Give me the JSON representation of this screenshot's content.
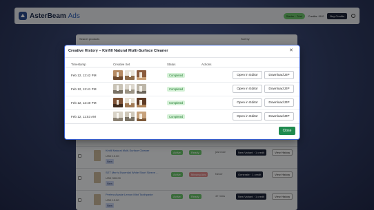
{
  "app": {
    "brand": "AsterBeam",
    "brand_accent": "Ads",
    "plan_badge": "Starter · Trial",
    "credits": "Credits: 99.0",
    "buy_credits": "Buy Credits",
    "help_icon": "help-circle-icon"
  },
  "background": {
    "search_label": "Search products",
    "sort_label": "Sort by",
    "rows": [
      {
        "name": "Kinfill Natural Multi-Surface Cleaner",
        "price": "USD 13.00",
        "badge": "New",
        "status": "Active",
        "tag": "Ready",
        "tag_color": "green",
        "date": "just now",
        "action": "New Variant · 1 credit",
        "history": "View History"
      },
      {
        "name": "SET Men's Essential White Short Sleeve ...",
        "price": "USD 300.00",
        "badge": "New",
        "status": "Active",
        "tag": "Missing Ads",
        "tag_color": "red",
        "date": "Never",
        "action": "Generate · 1 credit",
        "history": "View History"
      },
      {
        "name": "Perfera Awake Lemon Mint Toothpaste",
        "price": "USD 13.00",
        "badge": "New",
        "status": "Active",
        "tag": "Ready",
        "tag_color": "green",
        "date": "47 mins",
        "action": "New Variant · 1 credit",
        "history": "View History"
      }
    ]
  },
  "modal": {
    "title": "Creative History – Kinfill Natural Multi-Surface Cleaner",
    "close_icon": "x-icon",
    "columns": {
      "timestamp": "Timestamp",
      "creative_set": "Creative Set",
      "status": "Status",
      "actions": "Actions"
    },
    "rows": [
      {
        "timestamp": "Feb 12, 12:42 PM",
        "status": "Completed",
        "open": "Open in Editor",
        "download": "Download ZIP"
      },
      {
        "timestamp": "Feb 12, 12:41 PM",
        "status": "Completed",
        "open": "Open in Editor",
        "download": "Download ZIP"
      },
      {
        "timestamp": "Feb 12, 12:40 PM",
        "status": "Completed",
        "open": "Open in Editor",
        "download": "Download ZIP"
      },
      {
        "timestamp": "Feb 12, 11:53 AM",
        "status": "Completed",
        "open": "Open in Editor",
        "download": "Download ZIP"
      }
    ],
    "close_button": "Close"
  },
  "colors": {
    "backdrop": "#1b2238",
    "accent": "#3b62d6",
    "close_button": "#1f8a4f",
    "status_completed_bg": "#d5f1d7",
    "status_completed_text": "#1d7a2b"
  }
}
